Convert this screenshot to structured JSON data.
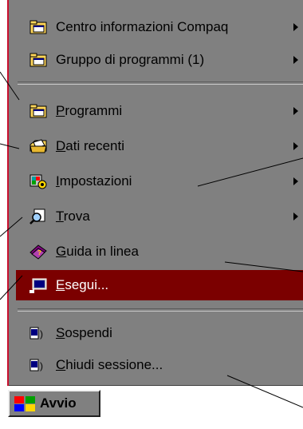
{
  "menu": {
    "items": [
      {
        "label": "Centro informazioni Compaq",
        "icon": "folder-program-icon",
        "has_submenu": true
      },
      {
        "label": "Gruppo di programmi (1)",
        "icon": "folder-program-icon",
        "has_submenu": true
      },
      {
        "label": "Programmi",
        "underline_char": "P",
        "icon": "folder-program-icon",
        "has_submenu": true
      },
      {
        "label": "Dati recenti",
        "underline_char": "D",
        "icon": "documents-folder-icon",
        "has_submenu": true
      },
      {
        "label": "Impostazioni",
        "underline_char": "I",
        "icon": "settings-icon",
        "has_submenu": true
      },
      {
        "label": "Trova",
        "underline_char": "T",
        "icon": "find-icon",
        "has_submenu": true
      },
      {
        "label": "Guida in linea",
        "underline_char": "G",
        "icon": "help-book-icon",
        "has_submenu": false
      },
      {
        "label": "Esegui...",
        "underline_char": "E",
        "icon": "run-icon",
        "has_submenu": false,
        "selected": true
      },
      {
        "label": "Sospendi",
        "underline_char": "S",
        "icon": "suspend-icon",
        "has_submenu": false
      },
      {
        "label": "Chiudi sessione...",
        "underline_char": "C",
        "icon": "shutdown-icon",
        "has_submenu": false
      }
    ]
  },
  "start_button": {
    "label": "Avvio"
  },
  "colors": {
    "menu_bg": "#808080",
    "selection": "#7b0000",
    "accent_bar": "#c8102e"
  }
}
